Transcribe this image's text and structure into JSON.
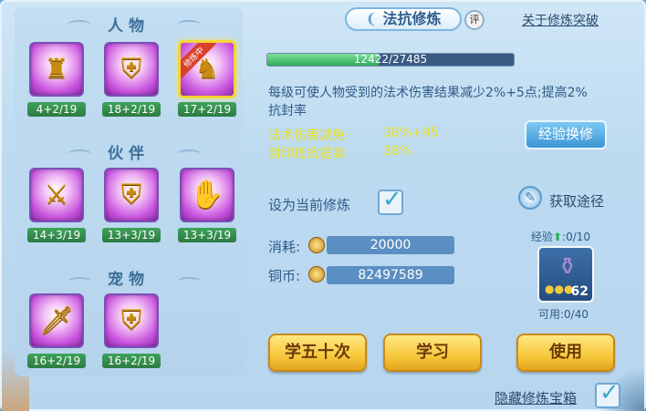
{
  "left_panel": {
    "sections": [
      {
        "title": "人物",
        "slots": [
          {
            "icon": "golden-figure-icon",
            "level": "4+2/19",
            "active": false
          },
          {
            "icon": "golden-armor-shield-icon",
            "level": "18+2/19",
            "active": false
          },
          {
            "icon": "golden-warrior-icon",
            "level": "17+2/19",
            "active": true,
            "ribbon": "修炼中"
          }
        ]
      },
      {
        "title": "伙伴",
        "slots": [
          {
            "icon": "beast-sword-icon",
            "level": "14+3/19",
            "active": false
          },
          {
            "icon": "beast-shield-icon",
            "level": "13+3/19",
            "active": false
          },
          {
            "icon": "beast-claw-icon",
            "level": "13+3/19",
            "active": false
          }
        ]
      },
      {
        "title": "宠物",
        "slots": [
          {
            "icon": "pet-sword-icon",
            "level": "16+2/19",
            "active": false
          },
          {
            "icon": "pet-shield-icon",
            "level": "16+2/19",
            "active": false
          }
        ]
      }
    ]
  },
  "header": {
    "title": "法抗修炼",
    "rate_label": "评",
    "breakthrough_link": "关于修炼突破"
  },
  "progress": {
    "current": 12422,
    "max": 27485,
    "label": "12422/27485"
  },
  "description": "每级可使人物受到的法术伤害结果减少2%+5点;提高2%抗封率",
  "stats": [
    {
      "label": "法术伤害减免:",
      "value": "38%+95"
    },
    {
      "label": "封印抵抗提高:",
      "value": "38%"
    }
  ],
  "exchange_button": "经验换修",
  "set_current": {
    "label": "设为当前修炼",
    "checked": true
  },
  "obtain_link": "获取途径",
  "resources": {
    "cost_label": "消耗:",
    "cost_value": "20000",
    "coin_label": "铜币:",
    "coin_value": "82497589"
  },
  "chest": {
    "exp_label": "经验",
    "exp_count": ":0/10",
    "item_count": "62",
    "usable_label": "可用:0/40"
  },
  "buttons": {
    "learn_fifty": "学五十次",
    "learn": "学习",
    "use": "使用"
  },
  "hide_chest": {
    "label": "隐藏修炼宝箱",
    "checked": true
  },
  "colors": {
    "accent_gold": "#f7c93c",
    "stat_yellow": "#e9e020",
    "progress_green": "#2fa85a",
    "slot_purple": "#c954df"
  }
}
